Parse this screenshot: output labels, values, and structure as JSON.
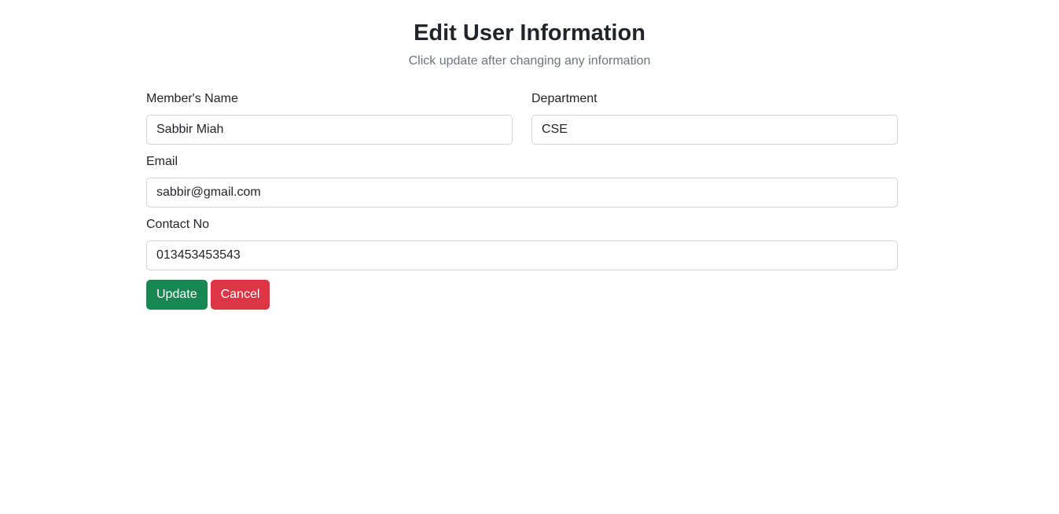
{
  "header": {
    "title": "Edit User Information",
    "subtitle": "Click update after changing any information"
  },
  "form": {
    "name": {
      "label": "Member's Name",
      "value": "Sabbir Miah"
    },
    "department": {
      "label": "Department",
      "value": "CSE"
    },
    "email": {
      "label": "Email",
      "value": "sabbir@gmail.com"
    },
    "contact": {
      "label": "Contact No",
      "value": "013453453543"
    }
  },
  "buttons": {
    "update_label": "Update",
    "cancel_label": "Cancel"
  },
  "colors": {
    "update": "#198754",
    "cancel": "#dc3545",
    "subtitle": "#6c757d"
  }
}
